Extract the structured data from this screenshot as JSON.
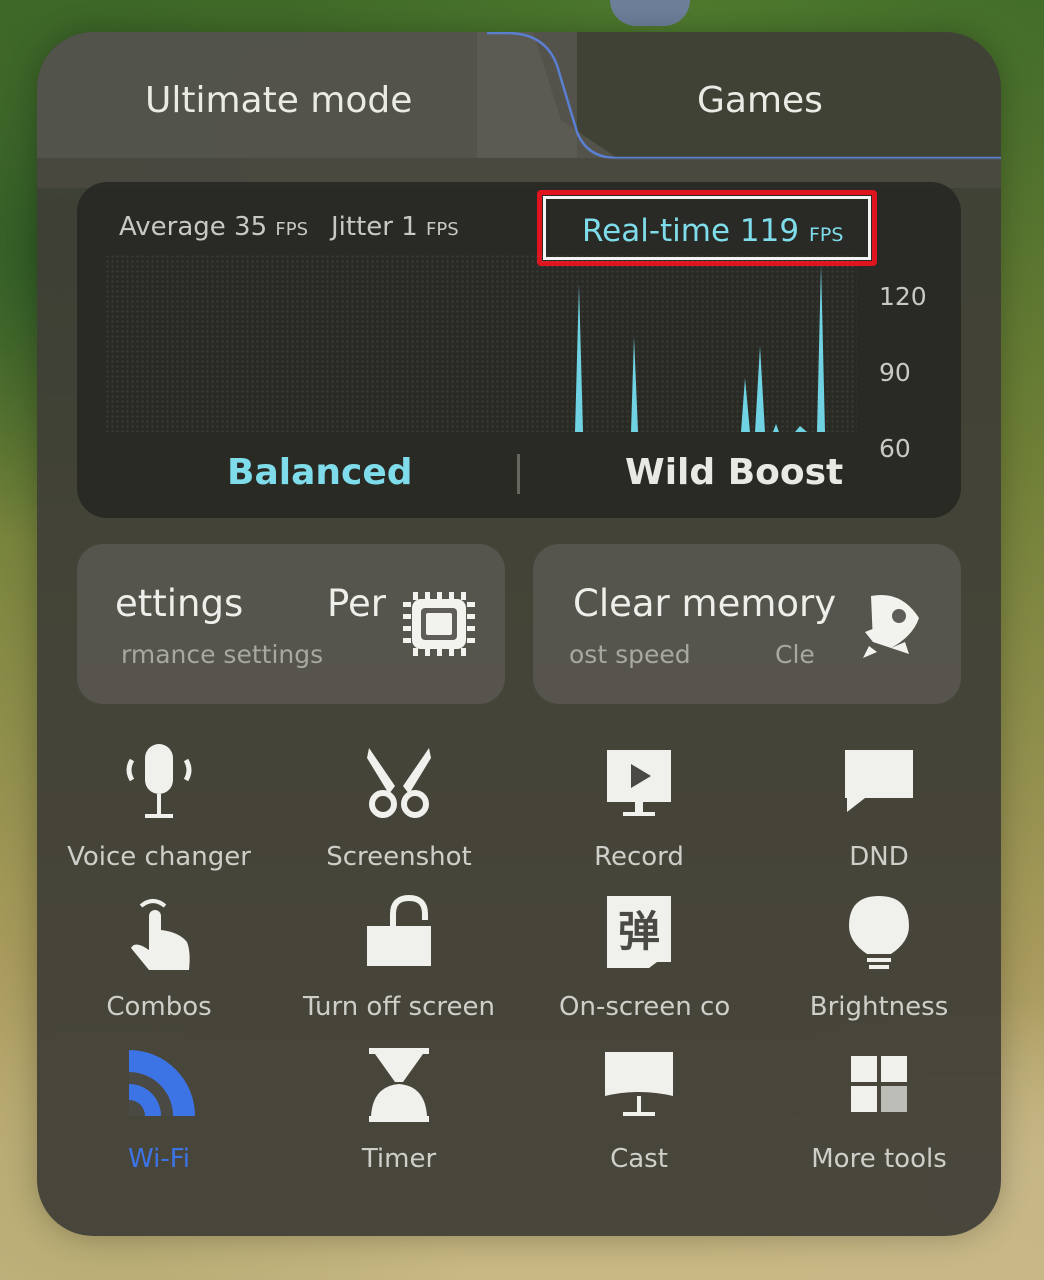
{
  "tabs": {
    "ultimate": "Ultimate mode",
    "games": "Games"
  },
  "fps": {
    "average_label": "Average 35",
    "average_unit": "FPS",
    "jitter_label": "Jitter 1",
    "jitter_unit": "FPS",
    "realtime_label": "Real-time 119",
    "realtime_unit": "FPS",
    "yticks": [
      "120",
      "90",
      "60"
    ]
  },
  "modes": {
    "balanced": "Balanced",
    "wild": "Wild Boost"
  },
  "cards": {
    "perf_title_a": "ettings",
    "perf_title_b": "Per",
    "perf_sub": "rmance settings",
    "clear_title": "Clear memory",
    "clear_sub_a": "ost speed",
    "clear_sub_b": "Cle"
  },
  "tools": {
    "voice": "Voice changer",
    "screenshot": "Screenshot",
    "record": "Record",
    "dnd": "DND",
    "combos": "Combos",
    "turnoff": "Turn off screen",
    "onscreen": "On-screen co",
    "brightness": "Brightness",
    "wifi": "Wi-Fi",
    "timer": "Timer",
    "cast": "Cast",
    "more": "More tools"
  },
  "colors": {
    "accent": "#7fdcea",
    "wifi_blue": "#3c74e6",
    "highlight_red": "#e0141e"
  }
}
